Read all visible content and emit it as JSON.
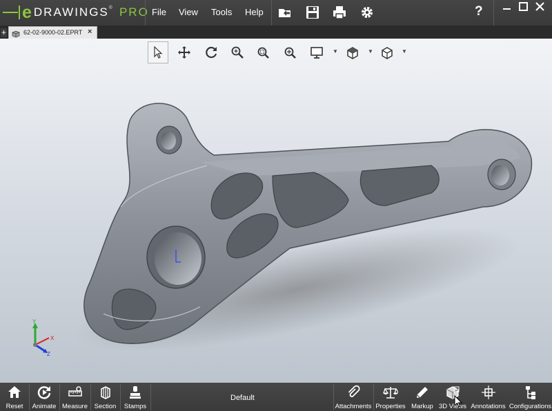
{
  "app": {
    "logo_letter": "e",
    "logo_name": "DRAWINGS",
    "logo_mark": "®",
    "logo_edition": "PRO"
  },
  "menu": {
    "items": [
      "File",
      "View",
      "Tools",
      "Help"
    ]
  },
  "toolbar": {
    "icons": [
      "open-file-icon",
      "save-icon",
      "print-icon",
      "settings-gear-icon"
    ],
    "help_label": "?"
  },
  "window": {
    "controls": [
      "minimize-icon",
      "maximize-icon",
      "close-icon"
    ]
  },
  "tabs": {
    "add_label": "+",
    "documents": [
      {
        "label": "62-02-9000-02.EPRT",
        "close_label": "×"
      }
    ]
  },
  "view_toolbar": {
    "tools": [
      "select-arrow-icon",
      "pan-icon",
      "rotate-icon",
      "zoom-to-fit-icon",
      "zoom-to-area-icon",
      "zoom-in-out-icon",
      "display-style-icon",
      "view-orientation-icon",
      "standard-views-icon"
    ],
    "active_tool": "select-arrow-icon"
  },
  "triad": {
    "x_label": "X",
    "y_label": "Y",
    "z_label": "Z"
  },
  "bottom_toolbar": {
    "left": [
      {
        "label": "Reset",
        "icon": "home-icon"
      },
      {
        "label": "Animate",
        "icon": "animate-icon"
      },
      {
        "label": "Measure",
        "icon": "measure-icon"
      },
      {
        "label": "Section",
        "icon": "section-icon"
      },
      {
        "label": "Stamps",
        "icon": "stamp-icon"
      }
    ],
    "configuration": "Default",
    "right": [
      {
        "label": "Attachments",
        "icon": "paperclip-icon"
      },
      {
        "label": "Properties",
        "icon": "scales-icon"
      },
      {
        "label": "Markup",
        "icon": "pencil-icon"
      },
      {
        "label": "3D Views",
        "icon": "3d-views-icon"
      },
      {
        "label": "Annotations",
        "icon": "annotations-icon"
      },
      {
        "label": "Configurations",
        "icon": "configurations-icon"
      }
    ]
  },
  "colors": {
    "accent": "#8dc63f",
    "bar": "#3f3f3f",
    "model": "#8e939a"
  }
}
